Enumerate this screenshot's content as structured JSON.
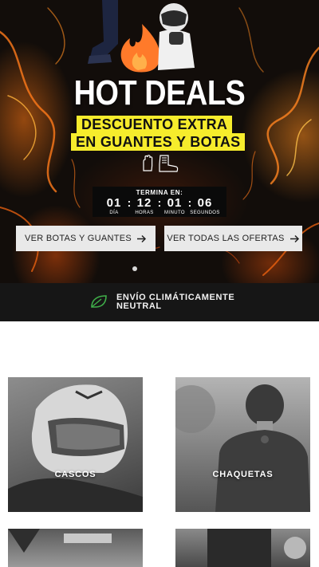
{
  "hero": {
    "title": "HOT DEALS",
    "promo_line_1": "DESCUENTO EXTRA",
    "promo_line_2": "EN GUANTES Y BOTAS",
    "countdown": {
      "label": "TERMINA EN:",
      "days": "01",
      "hours": "12",
      "minutes": "01",
      "seconds": "06",
      "days_label": "DÍA",
      "hours_label": "HORAS",
      "minutes_label": "MINUTO",
      "seconds_label": "SEGUNDOS"
    },
    "cta_boots_gloves": "VER BOTAS Y GUANTES",
    "cta_all_offers": "VER TODAS LAS OFERTAS",
    "accent_color": "#f6ec2c"
  },
  "shipping": {
    "text": "ENVÍO CLIMÁTICAMENTE NEUTRAL",
    "icon": "leaf-icon",
    "icon_color": "#3fae49"
  },
  "categories": [
    {
      "label": "CASCOS"
    },
    {
      "label": "CHAQUETAS"
    },
    {
      "label": ""
    },
    {
      "label": ""
    }
  ]
}
